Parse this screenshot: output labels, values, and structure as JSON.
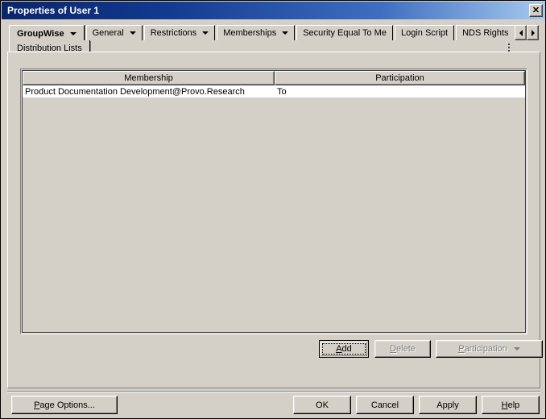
{
  "window": {
    "title": "Properties of User 1",
    "close_glyph": "✕",
    "close_label": "Close"
  },
  "tabs": {
    "row1": [
      {
        "label": "GroupWise",
        "has_caret": true,
        "selected": true
      },
      {
        "label": "General",
        "has_caret": true,
        "selected": false
      },
      {
        "label": "Restrictions",
        "has_caret": true,
        "selected": false
      },
      {
        "label": "Memberships",
        "has_caret": true,
        "selected": false
      },
      {
        "label": "Security Equal To Me",
        "has_caret": false,
        "selected": false
      },
      {
        "label": "Login Script",
        "has_caret": false,
        "selected": false
      },
      {
        "label": "NDS Rights",
        "has_caret": true,
        "selected": false
      }
    ],
    "subtab": {
      "label": "Distribution Lists",
      "selected": true
    },
    "scroll_left_label": "Scroll tabs left",
    "scroll_right_label": "Scroll tabs right"
  },
  "list": {
    "columns": [
      "Membership",
      "Participation"
    ],
    "rows": [
      {
        "membership": "Product Documentation Development@Provo.Research",
        "participation": "To"
      }
    ]
  },
  "list_buttons": [
    {
      "id": "add",
      "label": "Add",
      "mnemonic": "A",
      "disabled": false,
      "focused": true,
      "caret": false
    },
    {
      "id": "delete",
      "label": "Delete",
      "mnemonic": "D",
      "disabled": true,
      "focused": false,
      "caret": false
    },
    {
      "id": "participation",
      "label": "Participation",
      "mnemonic": "P",
      "disabled": true,
      "focused": false,
      "caret": true
    }
  ],
  "bottom_buttons": [
    {
      "id": "page_options",
      "label": "Page Options...",
      "mnemonic": "P"
    },
    {
      "id": "ok",
      "label": "OK",
      "mnemonic": ""
    },
    {
      "id": "cancel",
      "label": "Cancel",
      "mnemonic": ""
    },
    {
      "id": "apply",
      "label": "Apply",
      "mnemonic": ""
    },
    {
      "id": "help",
      "label": "Help",
      "mnemonic": "H"
    }
  ],
  "colors": {
    "face": "#d4d0c8",
    "title_start": "#0a246a",
    "title_end": "#a6caf0",
    "list_bg": "#ffffff",
    "disabled_text": "#808080"
  }
}
